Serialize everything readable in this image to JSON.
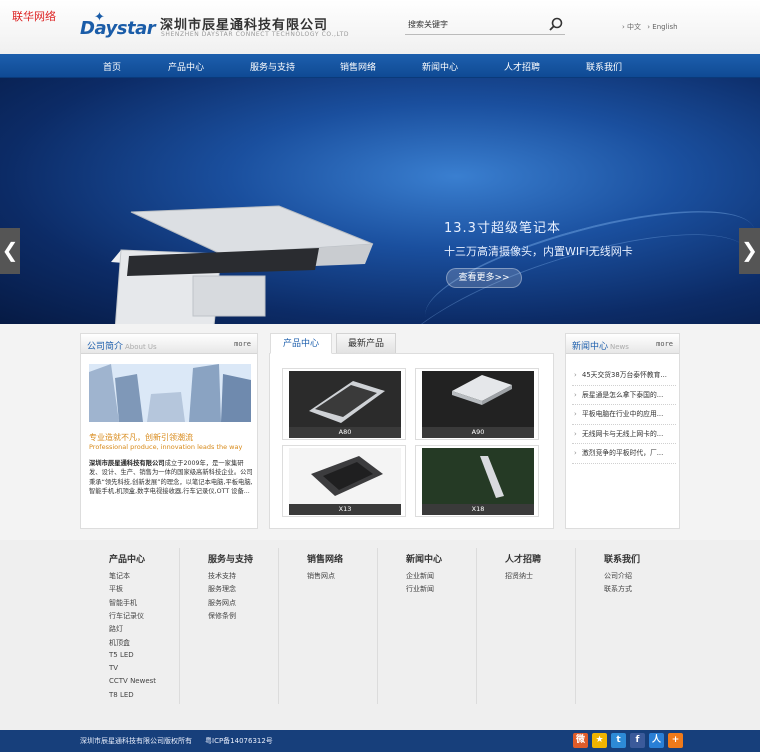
{
  "corner_tag": "联华网络",
  "logo": {
    "word": "Daystar"
  },
  "company": {
    "cn": "深圳市辰星通科技有限公司",
    "en": "SHENZHEN DAYSTAR CONNECT TECHNOLOGY CO.,LTD"
  },
  "search": {
    "placeholder": "搜索关键字"
  },
  "lang": {
    "cn": "› 中文",
    "en": "› English"
  },
  "nav": [
    "首页",
    "产品中心",
    "服务与支持",
    "销售网络",
    "新闻中心",
    "人才招聘",
    "联系我们"
  ],
  "banner": {
    "title": "13.3寸超级笔记本",
    "subtitle": "十三万高清摄像头，内置WIFI无线网卡",
    "button": "查看更多>>",
    "prev": "❮",
    "next": "❯"
  },
  "about": {
    "title": "公司简介",
    "title_en": "About Us",
    "more": "more",
    "slogan": "专业造就不凡，创新引领潮流",
    "slogan_en": "Professional produce, innovation leads the way",
    "company_name": "深圳市辰星通科技有限公司",
    "text": "成立于2009年，是一家集研发、设计、生产、销售为一体的国家级高新科技企业。公司秉承“领先科技,创新发展”的理念，以笔记本电脑,平板电脑,智能手机,机顶盒,数字电视接收器,行车记录仪,OTT 设备..."
  },
  "products": {
    "tabs": [
      "产品中心",
      "最新产品"
    ],
    "items": [
      {
        "name": "A80"
      },
      {
        "name": "A90"
      },
      {
        "name": "X13"
      },
      {
        "name": "X18"
      }
    ]
  },
  "news": {
    "title": "新闻中心",
    "title_en": "News",
    "more": "more",
    "items": [
      "45天交货38万台泰怀教育...",
      "辰星通是怎么拿下泰国的...",
      "平板电脑在行业中的应用...",
      "无线网卡与无线上网卡的...",
      "激烈竞争的平板时代，厂..."
    ]
  },
  "footer": {
    "columns": [
      {
        "title": "产品中心",
        "items": [
          "笔记本",
          "平板",
          "智能手机",
          "行车记录仪",
          "路灯",
          "机顶盒",
          "T5 LED",
          "TV",
          "CCTV Newest",
          "T8 LED"
        ]
      },
      {
        "title": "服务与支持",
        "items": [
          "技术支持",
          "服务理念",
          "服务网点",
          "保修条例"
        ]
      },
      {
        "title": "销售网络",
        "items": [
          "销售网点"
        ]
      },
      {
        "title": "新闻中心",
        "items": [
          "企业新闻",
          "行业新闻"
        ]
      },
      {
        "title": "人才招聘",
        "items": [
          "招贤纳士"
        ]
      },
      {
        "title": "联系我们",
        "items": [
          "公司介绍",
          "联系方式"
        ]
      }
    ]
  },
  "bottom": {
    "copyright": "深圳市辰星通科技有限公司版权所有",
    "icp": "粤ICP备14076312号",
    "share_icons": [
      {
        "name": "weibo-icon",
        "glyph": "微",
        "color": "#e05c2a"
      },
      {
        "name": "qzone-icon",
        "glyph": "★",
        "color": "#f0b400"
      },
      {
        "name": "tencent-weibo-icon",
        "glyph": "t",
        "color": "#2d8ad6"
      },
      {
        "name": "facebook-icon",
        "glyph": "f",
        "color": "#3b5a9a"
      },
      {
        "name": "renren-icon",
        "glyph": "人",
        "color": "#2a7fd6"
      },
      {
        "name": "more-share-icon",
        "glyph": "+",
        "color": "#f07a1a"
      }
    ]
  }
}
